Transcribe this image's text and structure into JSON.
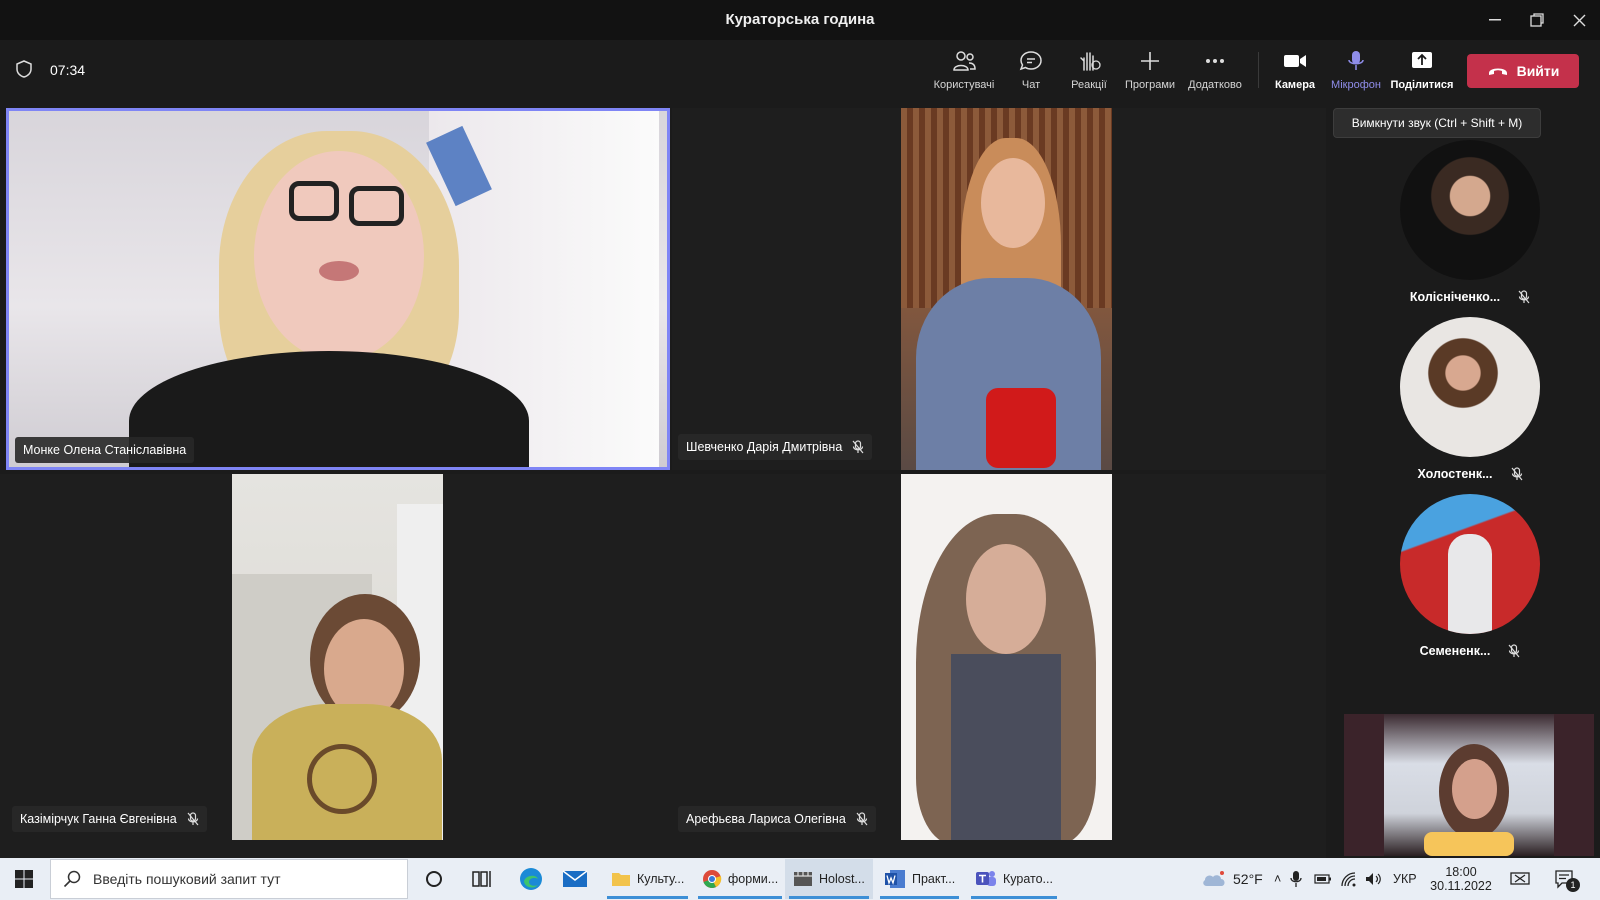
{
  "window": {
    "title": "Кураторська година"
  },
  "meeting": {
    "timer": "07:34",
    "toolbar": {
      "people": "Користувачі",
      "chat": "Чат",
      "reactions": "Реакції",
      "apps": "Програми",
      "more": "Додатково",
      "camera": "Камера",
      "mic": "Мікрофон",
      "share": "Поділитися",
      "leave": "Вийти"
    },
    "tooltip": "Вимкнути звук (Ctrl + Shift + M)"
  },
  "participants": [
    {
      "name": "Монке Олена Станіславівна",
      "muted": false,
      "speaking": true
    },
    {
      "name": "Шевченко Дарія Дмитрівна",
      "muted": true
    },
    {
      "name": "Казімірчук Ганна Євгенівна",
      "muted": true
    },
    {
      "name": "Арефьєва Лариса Олегівна",
      "muted": true
    }
  ],
  "sidebar": [
    {
      "name": "Колісніченко...",
      "short": "Колісніченко...",
      "muted": true
    },
    {
      "name": "Холостенк...",
      "muted": true
    },
    {
      "name": "Семененк...",
      "muted": true
    }
  ],
  "taskbar": {
    "search_placeholder": "Введіть пошуковий запит тут",
    "apps": [
      {
        "label": "Культу...",
        "icon": "folder-icon"
      },
      {
        "label": "форми...",
        "icon": "chrome-icon"
      },
      {
        "label": "Holost...",
        "icon": "video-editor-icon"
      },
      {
        "label": "Практ...",
        "icon": "word-icon"
      },
      {
        "label": "Курато...",
        "icon": "teams-icon"
      }
    ],
    "weather": "52°F",
    "language": "УКР",
    "time": "18:00",
    "date": "30.11.2022",
    "notifications": "1"
  }
}
